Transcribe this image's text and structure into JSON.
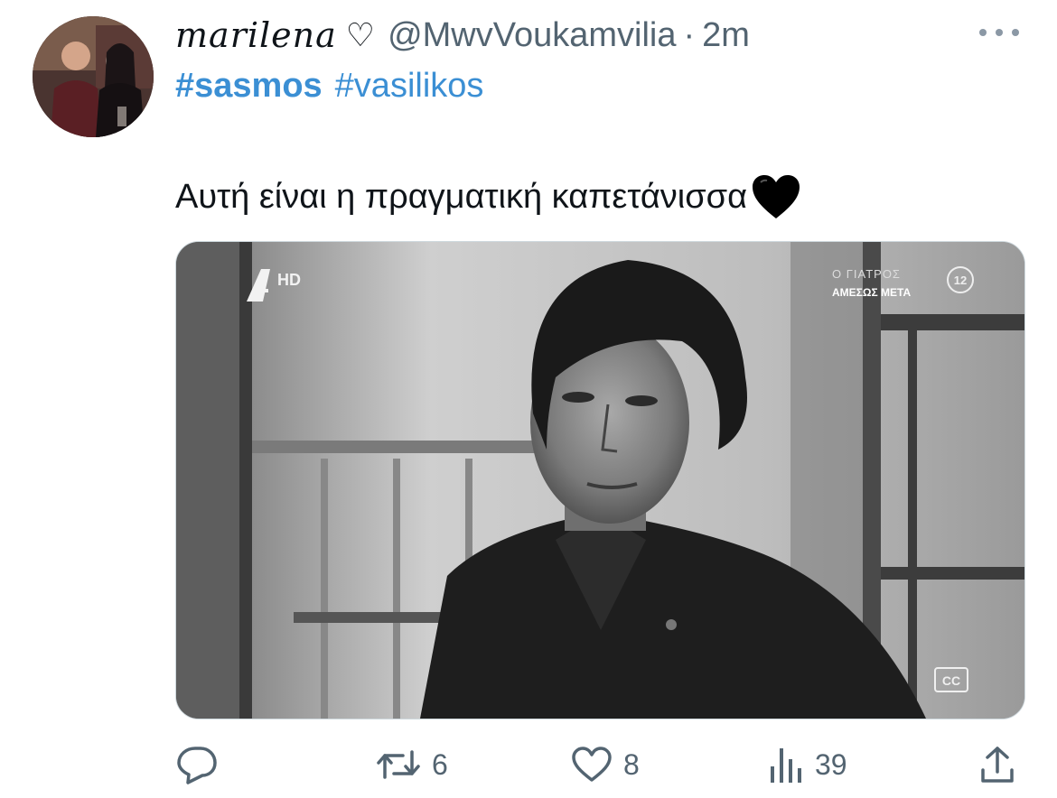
{
  "author": {
    "display_name": "marilena",
    "name_emoji": "♡",
    "handle": "@MwvVoukamvilia",
    "separator": "·",
    "time": "2m"
  },
  "hashtags": [
    "#sasmos",
    "#vasilikos"
  ],
  "tweet_text": "Αυτή είναι η πραγματική καπετάνισσα",
  "tweet_emoji": "black-heart-icon",
  "media": {
    "channel_logo": "Α",
    "channel_hd": "HD",
    "program_next_title": "Ο ΓΙΑΤΡΟΣ",
    "program_next_sub": "ΑΜΕΣΩΣ ΜΕΤΑ",
    "rating": "12",
    "cc_label": "CC"
  },
  "actions": {
    "reply_icon": "reply-icon",
    "retweet_icon": "retweet-icon",
    "retweets": "6",
    "like_icon": "heart-icon",
    "likes": "8",
    "views_icon": "views-icon",
    "views": "39",
    "share_icon": "share-icon"
  },
  "colors": {
    "text": "#0f1419",
    "secondary": "#536471",
    "hashtag": "#3b8fd4"
  }
}
